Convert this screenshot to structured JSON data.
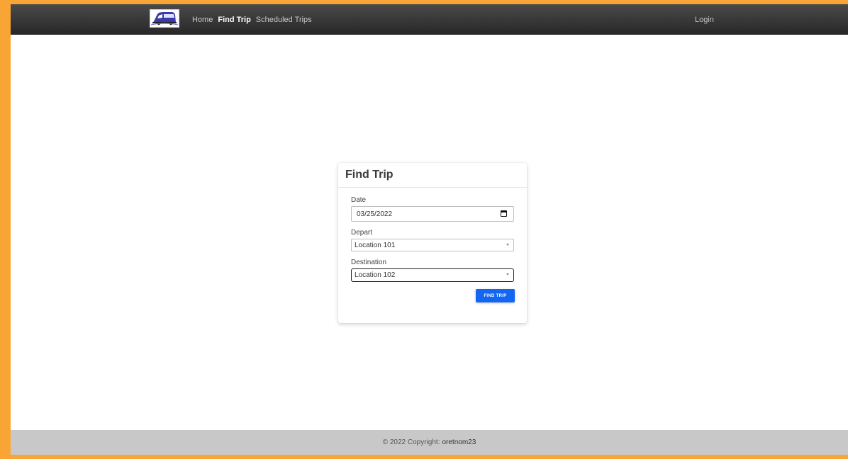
{
  "nav": {
    "links": [
      {
        "label": "Home",
        "active": false
      },
      {
        "label": "Find Trip",
        "active": true
      },
      {
        "label": "Scheduled Trips",
        "active": false
      }
    ],
    "login": "Login",
    "logo_icon": "bus-icon"
  },
  "card": {
    "title": "Find Trip",
    "date": {
      "label": "Date",
      "value": "03/25/2022",
      "icon": "calendar-icon"
    },
    "depart": {
      "label": "Depart",
      "value": "Location 101",
      "icon": "caret-down-icon"
    },
    "destination": {
      "label": "Destination",
      "value": "Location 102",
      "icon": "caret-down-icon"
    },
    "submit": "FIND TRIP"
  },
  "footer": {
    "copyright": "© 2022 Copyright:",
    "owner": "oretnom23"
  },
  "colors": {
    "frame": "#f9a536",
    "navbar": "#333333",
    "button": "#1266f1",
    "footer": "#c8c8c8"
  }
}
